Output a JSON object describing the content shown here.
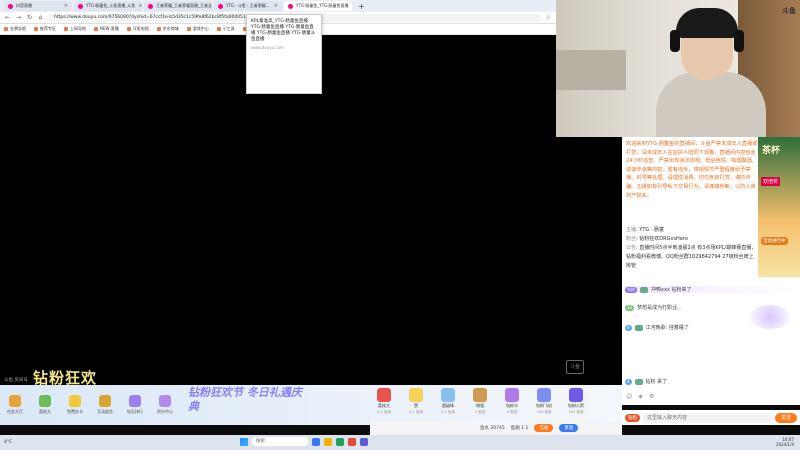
{
  "browser": {
    "tabs": [
      {
        "label": "抖音直播"
      },
      {
        "label": "YTG·肠童鱼_斗鱼直播_斗鱼"
      },
      {
        "label": "王者荣耀_王者荣耀直播_王者全"
      },
      {
        "label": "YTG · 斗鱼 · 王者荣耀..."
      },
      {
        "label": "YTG·肠童鱼_YTG·肠童鱼直播"
      }
    ],
    "url": "https://www.douyu.com/9756090?dyshid=67ccf1e-b5d35c1c59fe8f62bc8f5fa000051",
    "bookmarks": [
      "金牌导航",
      "推荐专区",
      "上网导航",
      "NEW 直播",
      "牙医电视",
      "京东商城",
      "游戏中心",
      "小工具",
      "我的淘宝"
    ]
  },
  "popup": {
    "text": "KPL秦准高_YTG·肠童鱼直播 YTG·肠童鱼直播 YTG·肠童鱼直播 YTG·肠童鱼直播 YTG·肠童斗鱼直播",
    "source": "www.douyu.com"
  },
  "video": {
    "banner_text": "钻粉狂欢",
    "small_user": "斗鱼 房间号",
    "watermark": "斗鱼"
  },
  "cam": {
    "logo": "斗鱼"
  },
  "sidebar_ad": {
    "title": "茶杯",
    "tag1": "双倍奖",
    "tag2": "活动进行中"
  },
  "system_message": "欢迎来到YTG·肠童鱼的直播间，斗鱼严禁未成年人直播或打赏，请未成年人在监护人陪同下观看。直播间内容包含24小时巡查。严禁出现违法违规、低俗色情、吸烟酗酒、造谣传谣等内容。若有违反，将视情节严重程度给予禁播、封号等处理。请理性消费，切勿盲目打赏，谨防诈骗。主播如有引导私下交易行为，请谨慎判断，以防人身财产损失。",
  "info": {
    "host_label": "主播",
    "host_value": "YTG · 肠童",
    "fan_label": "粉丝",
    "fan_value": "钻粉狂欢DRGvsHero",
    "notice_label": "公告",
    "notice_value": "直播时间5点半到凌晨2点 有3点场KPL/巅峰赛直播，钻粉福利看微博。QQ粉丝群1029842794 27级粉丝牌上房管"
  },
  "chat": [
    {
      "badge": "钻粉",
      "badge_color": "#8a6cf0",
      "name": "",
      "text": "冲鸭xxx 钻粉来了"
    },
    {
      "badge": "12",
      "badge_color": "#7bc97b",
      "name": "",
      "text": "梦想是成为打职业..."
    },
    {
      "badge": "6",
      "badge_color": "#5fa6e8",
      "name": "",
      "text": "江河晚歌: 挂着睡了"
    },
    {
      "badge": "4",
      "badge_color": "#5fa6e8",
      "name": "",
      "text": "钻粉 来了"
    }
  ],
  "gift_bar": {
    "left_buttons": [
      "任务大厅",
      "荔枝大",
      "免费办卡",
      "互动留言",
      "钻石排行",
      "积分中心"
    ],
    "festival_text": "钻粉狂欢节 冬日礼遇庆典",
    "gifts": [
      {
        "label": "荔枝大",
        "price": "0.1 鱼翅"
      },
      {
        "label": "赞",
        "price": "0.1 鱼翅"
      },
      {
        "label": "超级棒",
        "price": "0.1 鱼翅"
      },
      {
        "label": "增强",
        "price": "2 鱼翅"
      },
      {
        "label": "钻粉卡",
        "price": "6 鱼翅"
      },
      {
        "label": "钻粉飞机",
        "price": "100 鱼翅"
      },
      {
        "label": "钻粉火箭",
        "price": "500 鱼翅"
      }
    ],
    "balance_1": "鱼丸 20745",
    "balance_2": "鱼翅 1.1",
    "charge": "充值",
    "shop": "贵族"
  },
  "chat_input": {
    "fan_badge": "钻粉",
    "placeholder": "这里输入聊天内容",
    "send": "发送"
  },
  "taskbar": {
    "weather": "4°C",
    "search": "搜索",
    "time": "16:07",
    "date": "2024/1/4"
  }
}
